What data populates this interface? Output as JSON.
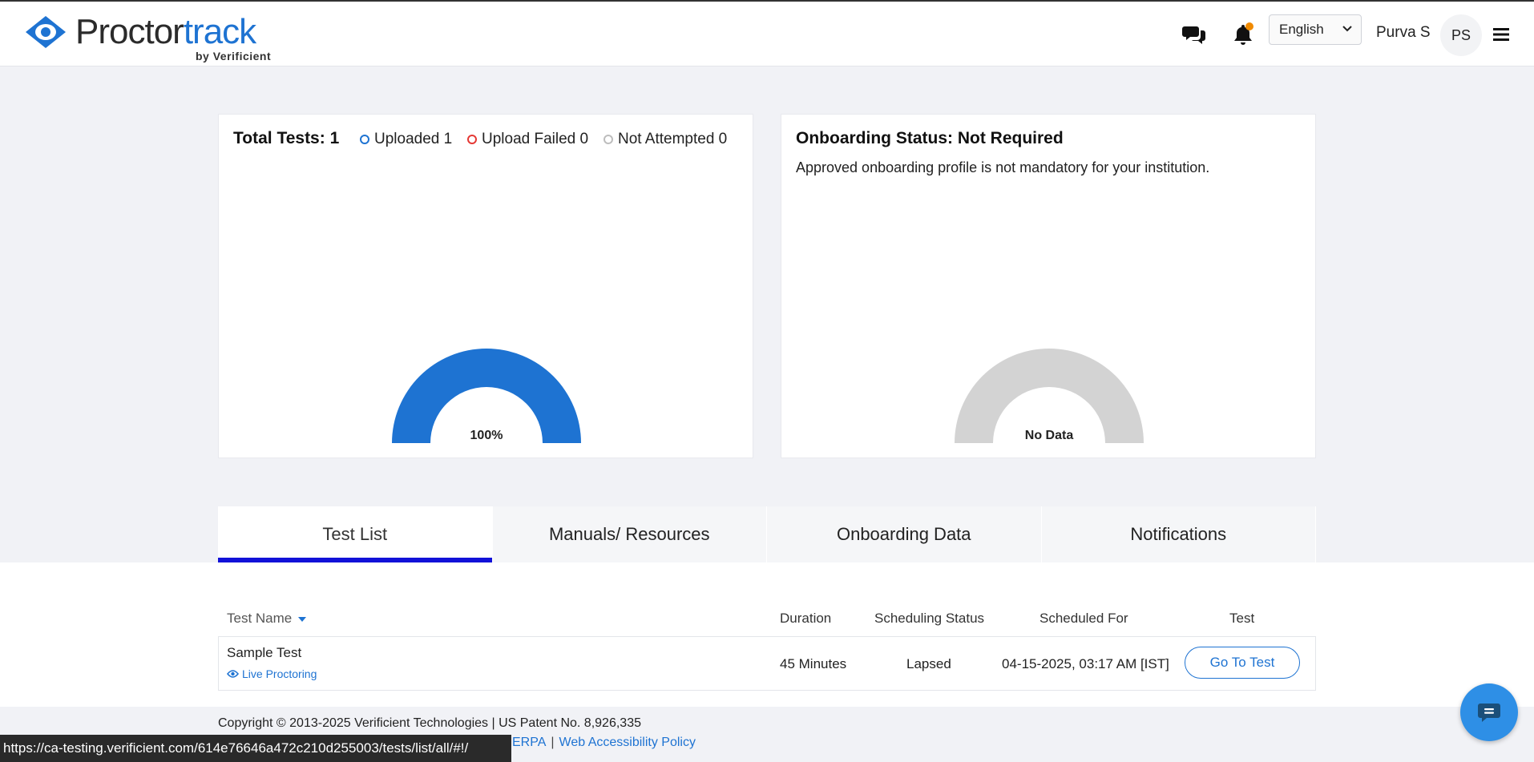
{
  "header": {
    "logo_part1": "Proctor",
    "logo_part2": "track",
    "logo_sub": "by Verificient",
    "language": "English",
    "user_name": "Purva S",
    "avatar_initials": "PS"
  },
  "summary": {
    "title": "Total Tests: 1",
    "legend": [
      {
        "label": "Uploaded 1",
        "color": "#1e73d2"
      },
      {
        "label": "Upload Failed 0",
        "color": "#e53935"
      },
      {
        "label": "Not Attempted 0",
        "color": "#bdbdbd"
      }
    ],
    "gauge_label": "100%",
    "gauge_fraction": 1.0
  },
  "onboarding": {
    "title": "Onboarding Status: Not Required",
    "description": "Approved onboarding profile is not mandatory for your institution.",
    "gauge_label": "No Data"
  },
  "tabs": [
    {
      "label": "Test List",
      "active": true
    },
    {
      "label": "Manuals/ Resources",
      "active": false
    },
    {
      "label": "Onboarding Data",
      "active": false
    },
    {
      "label": "Notifications",
      "active": false
    }
  ],
  "table": {
    "headers": {
      "name": "Test Name",
      "duration": "Duration",
      "scheduling_status": "Scheduling Status",
      "scheduled_for": "Scheduled For",
      "test": "Test"
    },
    "rows": [
      {
        "name": "Sample Test",
        "proctoring": "Live Proctoring",
        "duration": "45 Minutes",
        "status": "Lapsed",
        "scheduled_for": "04-15-2025, 03:17 AM [IST]",
        "action": "Go To Test"
      }
    ]
  },
  "footer": {
    "copyright": "Copyright © 2013-2025 Verificient Technologies | US Patent No. 8,926,335",
    "link1": "ERPA",
    "link2": "Web Accessibility Policy",
    "separator": "|"
  },
  "status_bar": {
    "url": "https://ca-testing.verificient.com/614e76646a472c210d255003/tests/list/all/#!/"
  },
  "colors": {
    "accent": "#1e73d2",
    "active_tab": "#1212d8",
    "gauge_empty": "#d3d3d3",
    "notification_dot": "#f08a00"
  }
}
